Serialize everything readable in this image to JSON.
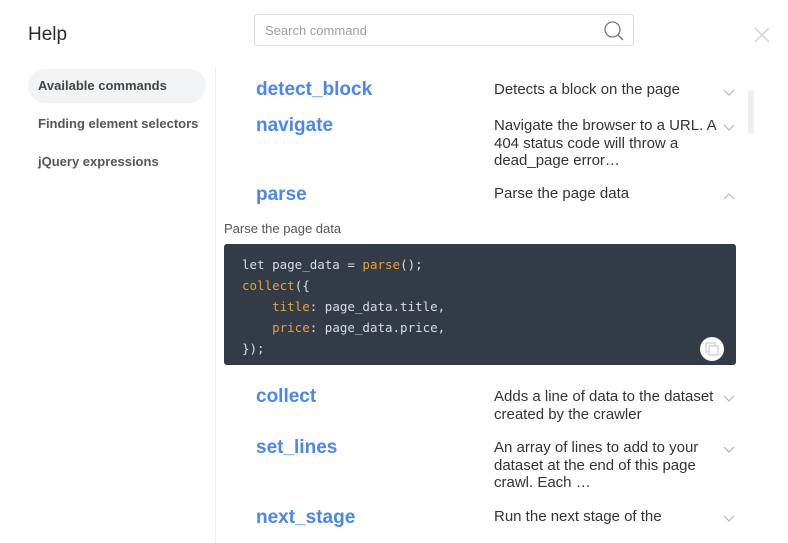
{
  "header": {
    "title": "Help",
    "search_placeholder": "Search command"
  },
  "sidebar": {
    "items": [
      {
        "label": "Available commands",
        "active": true
      },
      {
        "label": "Finding element selectors"
      },
      {
        "label": "jQuery expressions"
      }
    ]
  },
  "commands": [
    {
      "name": "detect_block",
      "description": "Detects a block on the page",
      "expanded": false
    },
    {
      "name": "navigate",
      "description": "Navigate the browser to a URL. A 404 status code will throw a dead_page error…",
      "expanded": false
    },
    {
      "name": "parse",
      "description": "Parse the page data",
      "expanded": true,
      "detail": "Parse the page data"
    },
    {
      "name": "collect",
      "description": "Adds a line of data to the dataset created by the crawler",
      "expanded": false
    },
    {
      "name": "set_lines",
      "description": "An array of lines to add to your dataset at the end of this page crawl. Each …",
      "expanded": false
    },
    {
      "name": "next_stage",
      "description": "Run the next stage of the",
      "expanded": false
    }
  ],
  "code": {
    "l1a": "let page_data = ",
    "l1b": "parse",
    "l1c": "();",
    "l2a": "collect",
    "l2b": "({",
    "l3a": "    ",
    "l3b": "title",
    "l3c": ": page_data.title,",
    "l4a": "    ",
    "l4b": "price",
    "l4c": ": page_data.price,",
    "l5": "});"
  },
  "colors": {
    "accent": "#4a86f0",
    "code_bg": "#323b46",
    "keyword": "#e6a23c"
  }
}
